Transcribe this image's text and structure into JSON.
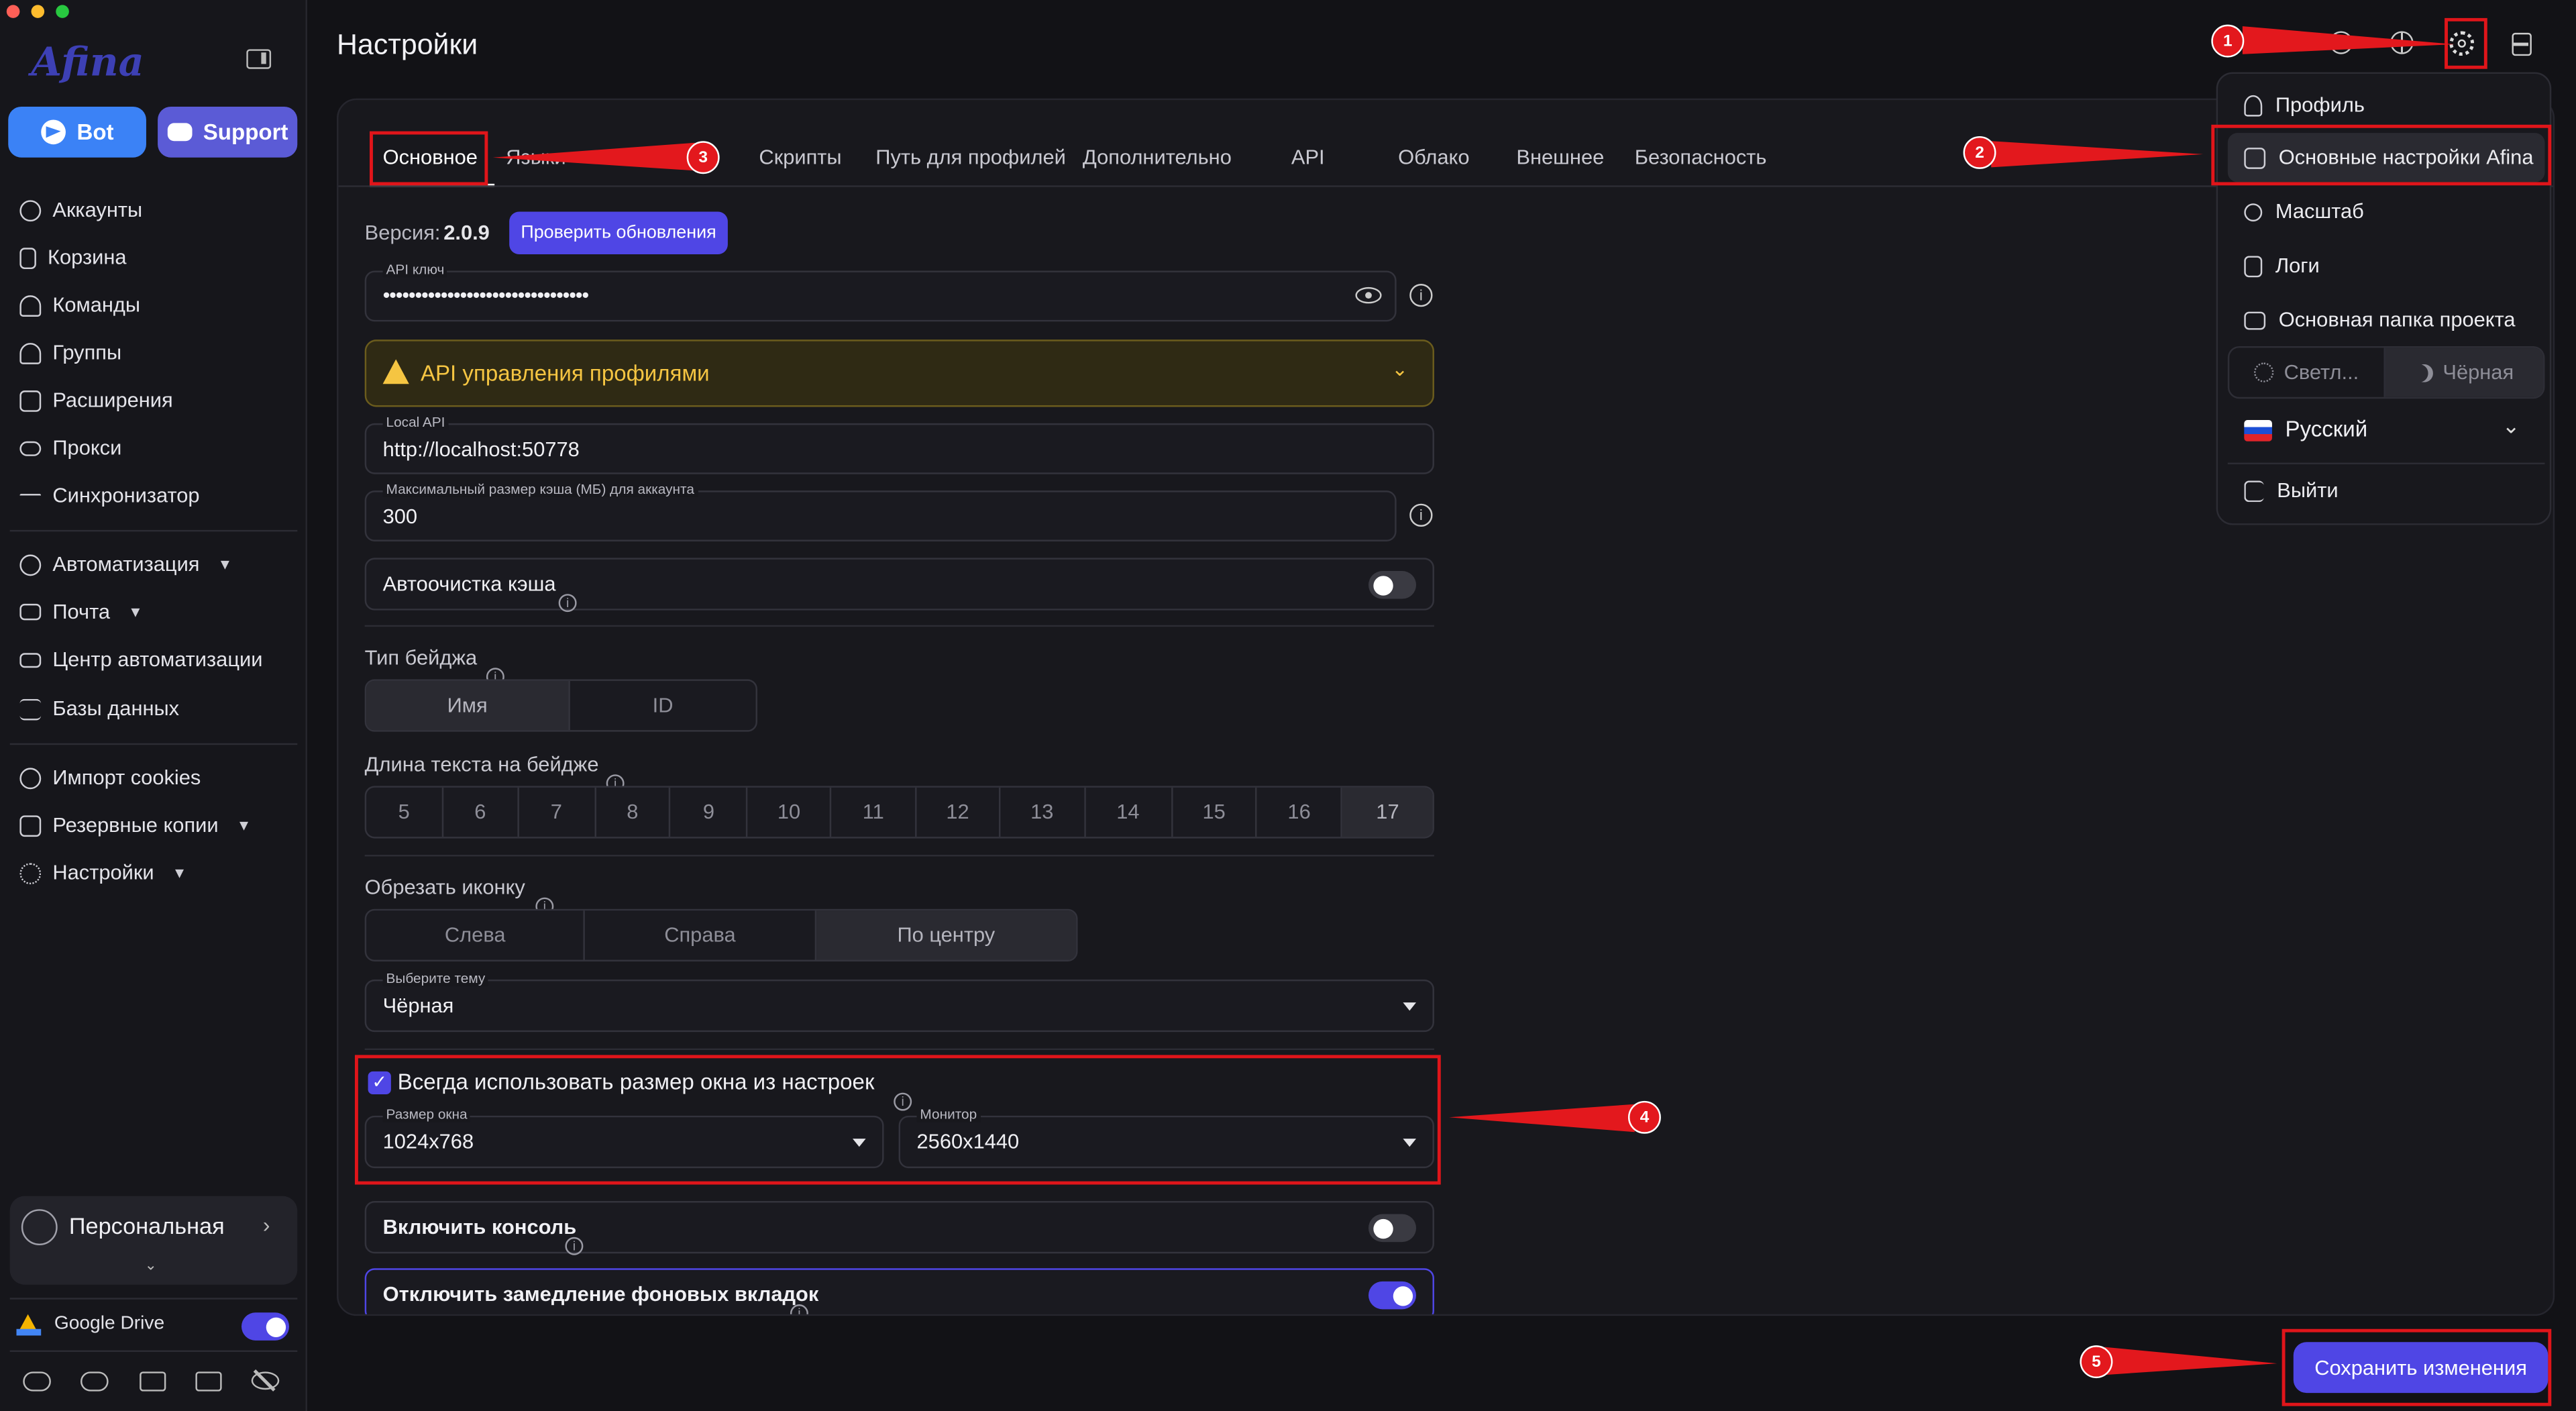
{
  "app": {
    "logo": "Afina"
  },
  "sidebar": {
    "bot_button": "Bot",
    "support_button": "Support",
    "nav": [
      {
        "label": "Аккаунты",
        "icon": "user-circle-icon"
      },
      {
        "label": "Корзина",
        "icon": "trash-icon"
      },
      {
        "label": "Команды",
        "icon": "users-icon"
      },
      {
        "label": "Группы",
        "icon": "group-icon"
      },
      {
        "label": "Расширения",
        "icon": "puzzle-icon"
      },
      {
        "label": "Прокси",
        "icon": "cloud-icon"
      },
      {
        "label": "Синхронизатор",
        "icon": "sync-icon"
      }
    ],
    "nav2": [
      {
        "label": "Автоматизация",
        "icon": "automation-icon"
      },
      {
        "label": "Почта",
        "icon": "mail-icon"
      },
      {
        "label": "Центр автоматизации",
        "icon": "laptop-icon"
      },
      {
        "label": "Базы данных",
        "icon": "list-icon"
      }
    ],
    "nav3": [
      {
        "label": "Импорт cookies",
        "icon": "cookie-icon"
      },
      {
        "label": "Резервные копии",
        "icon": "backup-icon"
      },
      {
        "label": "Настройки",
        "icon": "gear-icon"
      }
    ],
    "workspace": "Персональная",
    "google_drive": "Google Drive"
  },
  "header": {
    "title": "Настройки"
  },
  "tabs": [
    "Основное",
    "Языки",
    "Скрипты",
    "Путь для профилей",
    "Дополнительно",
    "API",
    "Облако",
    "Внешнее",
    "Безопасность"
  ],
  "settings": {
    "version_label": "Версия:",
    "version_value": "2.0.9",
    "check_updates": "Проверить обновления",
    "api_key_label": "API ключ",
    "api_key_value": "••••••••••••••••••••••••••••••••",
    "api_section": "API управления профилями",
    "local_api_label": "Local API",
    "local_api_value": "http://localhost:50778",
    "cache_label": "Максимальный размер кэша (МБ) для аккаунта",
    "cache_value": "300",
    "autoclean_label": "Автоочистка кэша",
    "autoclean_on": false,
    "badge_type_label": "Тип бейджа",
    "badge_type_options": [
      "Имя",
      "ID"
    ],
    "badge_type_selected": "Имя",
    "badge_len_label": "Длина текста на бейдже",
    "badge_len_options": [
      "5",
      "6",
      "7",
      "8",
      "9",
      "10",
      "11",
      "12",
      "13",
      "14",
      "15",
      "16",
      "17"
    ],
    "badge_len_selected": "17",
    "crop_label": "Обрезать иконку",
    "crop_options": [
      "Слева",
      "Справа",
      "По центру"
    ],
    "crop_selected": "По центру",
    "theme_label": "Выберите тему",
    "theme_value": "Чёрная",
    "window_size_checkbox": "Всегда использовать размер окна из настроек",
    "window_size_checked": true,
    "window_size_label": "Размер окна",
    "window_size_value": "1024x768",
    "monitor_label": "Монитор",
    "monitor_value": "2560x1440",
    "console_label": "Включить консоль",
    "console_on": false,
    "throttle_label": "Отключить замедление фоновых вкладок",
    "throttle_on": true
  },
  "save_button": "Сохранить изменения",
  "dropdown": {
    "profile": "Профиль",
    "main_settings": "Основные настройки Afina",
    "zoom": "Масштаб",
    "logs": "Логи",
    "project_folder": "Основная папка проекта",
    "theme_light": "Светл...",
    "theme_dark": "Чёрная",
    "language": "Русский",
    "logout": "Выйти"
  },
  "annotations": [
    "1",
    "2",
    "3",
    "4",
    "5"
  ],
  "colors": {
    "accent": "#4f46e5",
    "annotation_red": "#e3181d",
    "background": "#121216",
    "warning": "#f5c542"
  }
}
